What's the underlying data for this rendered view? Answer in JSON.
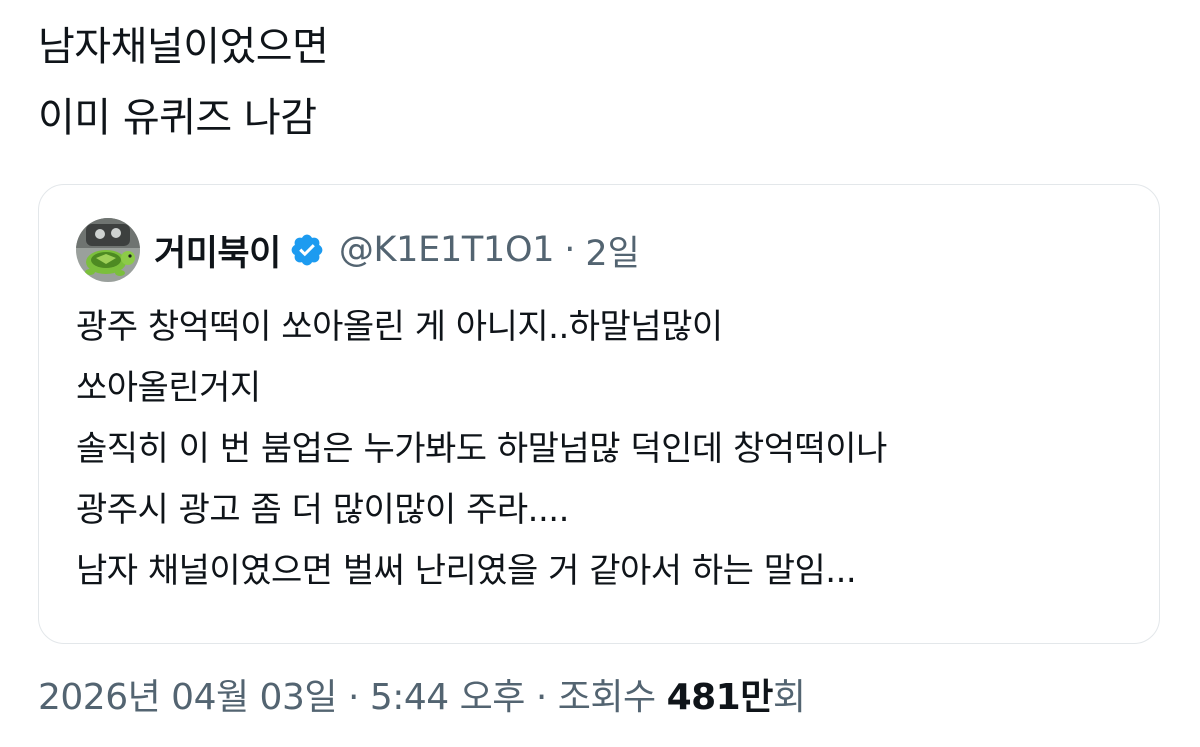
{
  "tweet": {
    "lines": [
      "남자채널이었으면",
      "이미 유퀴즈 나감"
    ]
  },
  "quote": {
    "author_name": "거미북이",
    "handle": "@K1E1T1O1",
    "separator": "·",
    "time_ago": "2일",
    "avatar_icon": "turtle-avatar-icon",
    "verified_icon": "verified-badge-icon",
    "verified_color": "#1d9bf0",
    "lines": [
      "광주 창억떡이 쏘아올린 게 아니지..하말넘많이",
      "쏘아올린거지",
      "솔직히 이 번 붐업은 누가봐도 하말넘많 덕인데 창억떡이나",
      "광주시 광고 좀 더 많이많이 주라....",
      "남자 채널이였으면 벌써 난리였을 거 같아서 하는 말임..."
    ]
  },
  "meta": {
    "date": "2026년 04월 03일",
    "separator": "·",
    "time": "5:44 오후",
    "views_label": "조회수",
    "views_count": "481만",
    "views_suffix": "회"
  },
  "colors": {
    "text_primary": "#0f1419",
    "text_secondary": "#536471",
    "card_border": "#e3e7ea"
  }
}
